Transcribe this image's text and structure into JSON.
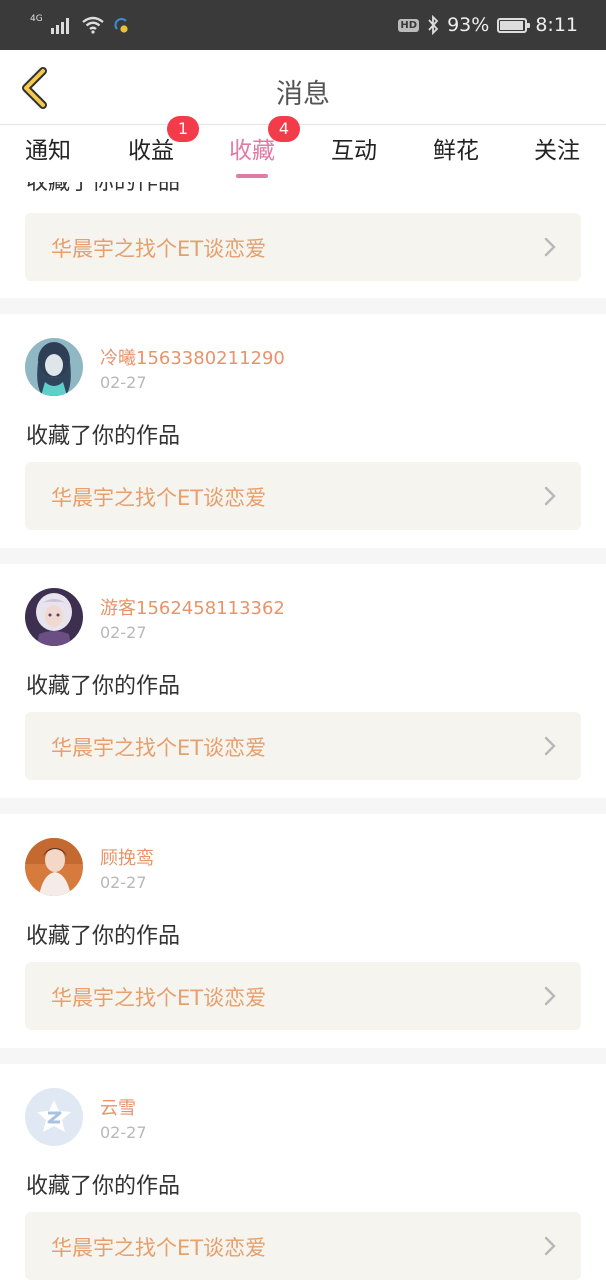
{
  "status_bar": {
    "network": "4G",
    "battery_percent": "93%",
    "battery_level": 0.93,
    "time": "8:11",
    "hd_label": "HD",
    "icons": [
      "signal-icon",
      "wifi-icon",
      "data-saver-icon",
      "bluetooth-icon",
      "battery-icon"
    ]
  },
  "header": {
    "title": "消息",
    "back_icon": "chevron-left-icon"
  },
  "tabs": [
    {
      "label": "通知",
      "badge": ""
    },
    {
      "label": "收益",
      "badge": "1"
    },
    {
      "label": "收藏",
      "badge": "4",
      "active": true
    },
    {
      "label": "互动",
      "badge": ""
    },
    {
      "label": "鲜花",
      "badge": ""
    },
    {
      "label": "关注",
      "badge": ""
    }
  ],
  "partial_item": {
    "action": "收藏了你的作品",
    "work_title": "华晨宇之找个ET谈恋爱"
  },
  "items": [
    {
      "user": "冷曦1563380211290",
      "date": "02-27",
      "action": "收藏了你的作品",
      "work_title": "华晨宇之找个ET谈恋爱",
      "avatar": "anime-girl-teal-avatar"
    },
    {
      "user": "游客1562458113362",
      "date": "02-27",
      "action": "收藏了你的作品",
      "work_title": "华晨宇之找个ET谈恋爱",
      "avatar": "anime-girl-purple-avatar"
    },
    {
      "user": "顾挽鸾",
      "date": "02-27",
      "action": "收藏了你的作品",
      "work_title": "华晨宇之找个ET谈恋爱",
      "avatar": "girl-photo-avatar"
    },
    {
      "user": "云雪",
      "date": "02-27",
      "action": "收藏了你的作品",
      "work_title": "华晨宇之找个ET谈恋爱",
      "avatar": "default-qq-avatar"
    }
  ],
  "colors": {
    "accent_pink": "#e07aa6",
    "badge_red": "#f43b4a",
    "username_orange": "#e7946a",
    "work_title_orange": "#e69f6d",
    "work_box_bg": "#f5f4ee",
    "status_bar_bg": "#3a3a3a"
  }
}
